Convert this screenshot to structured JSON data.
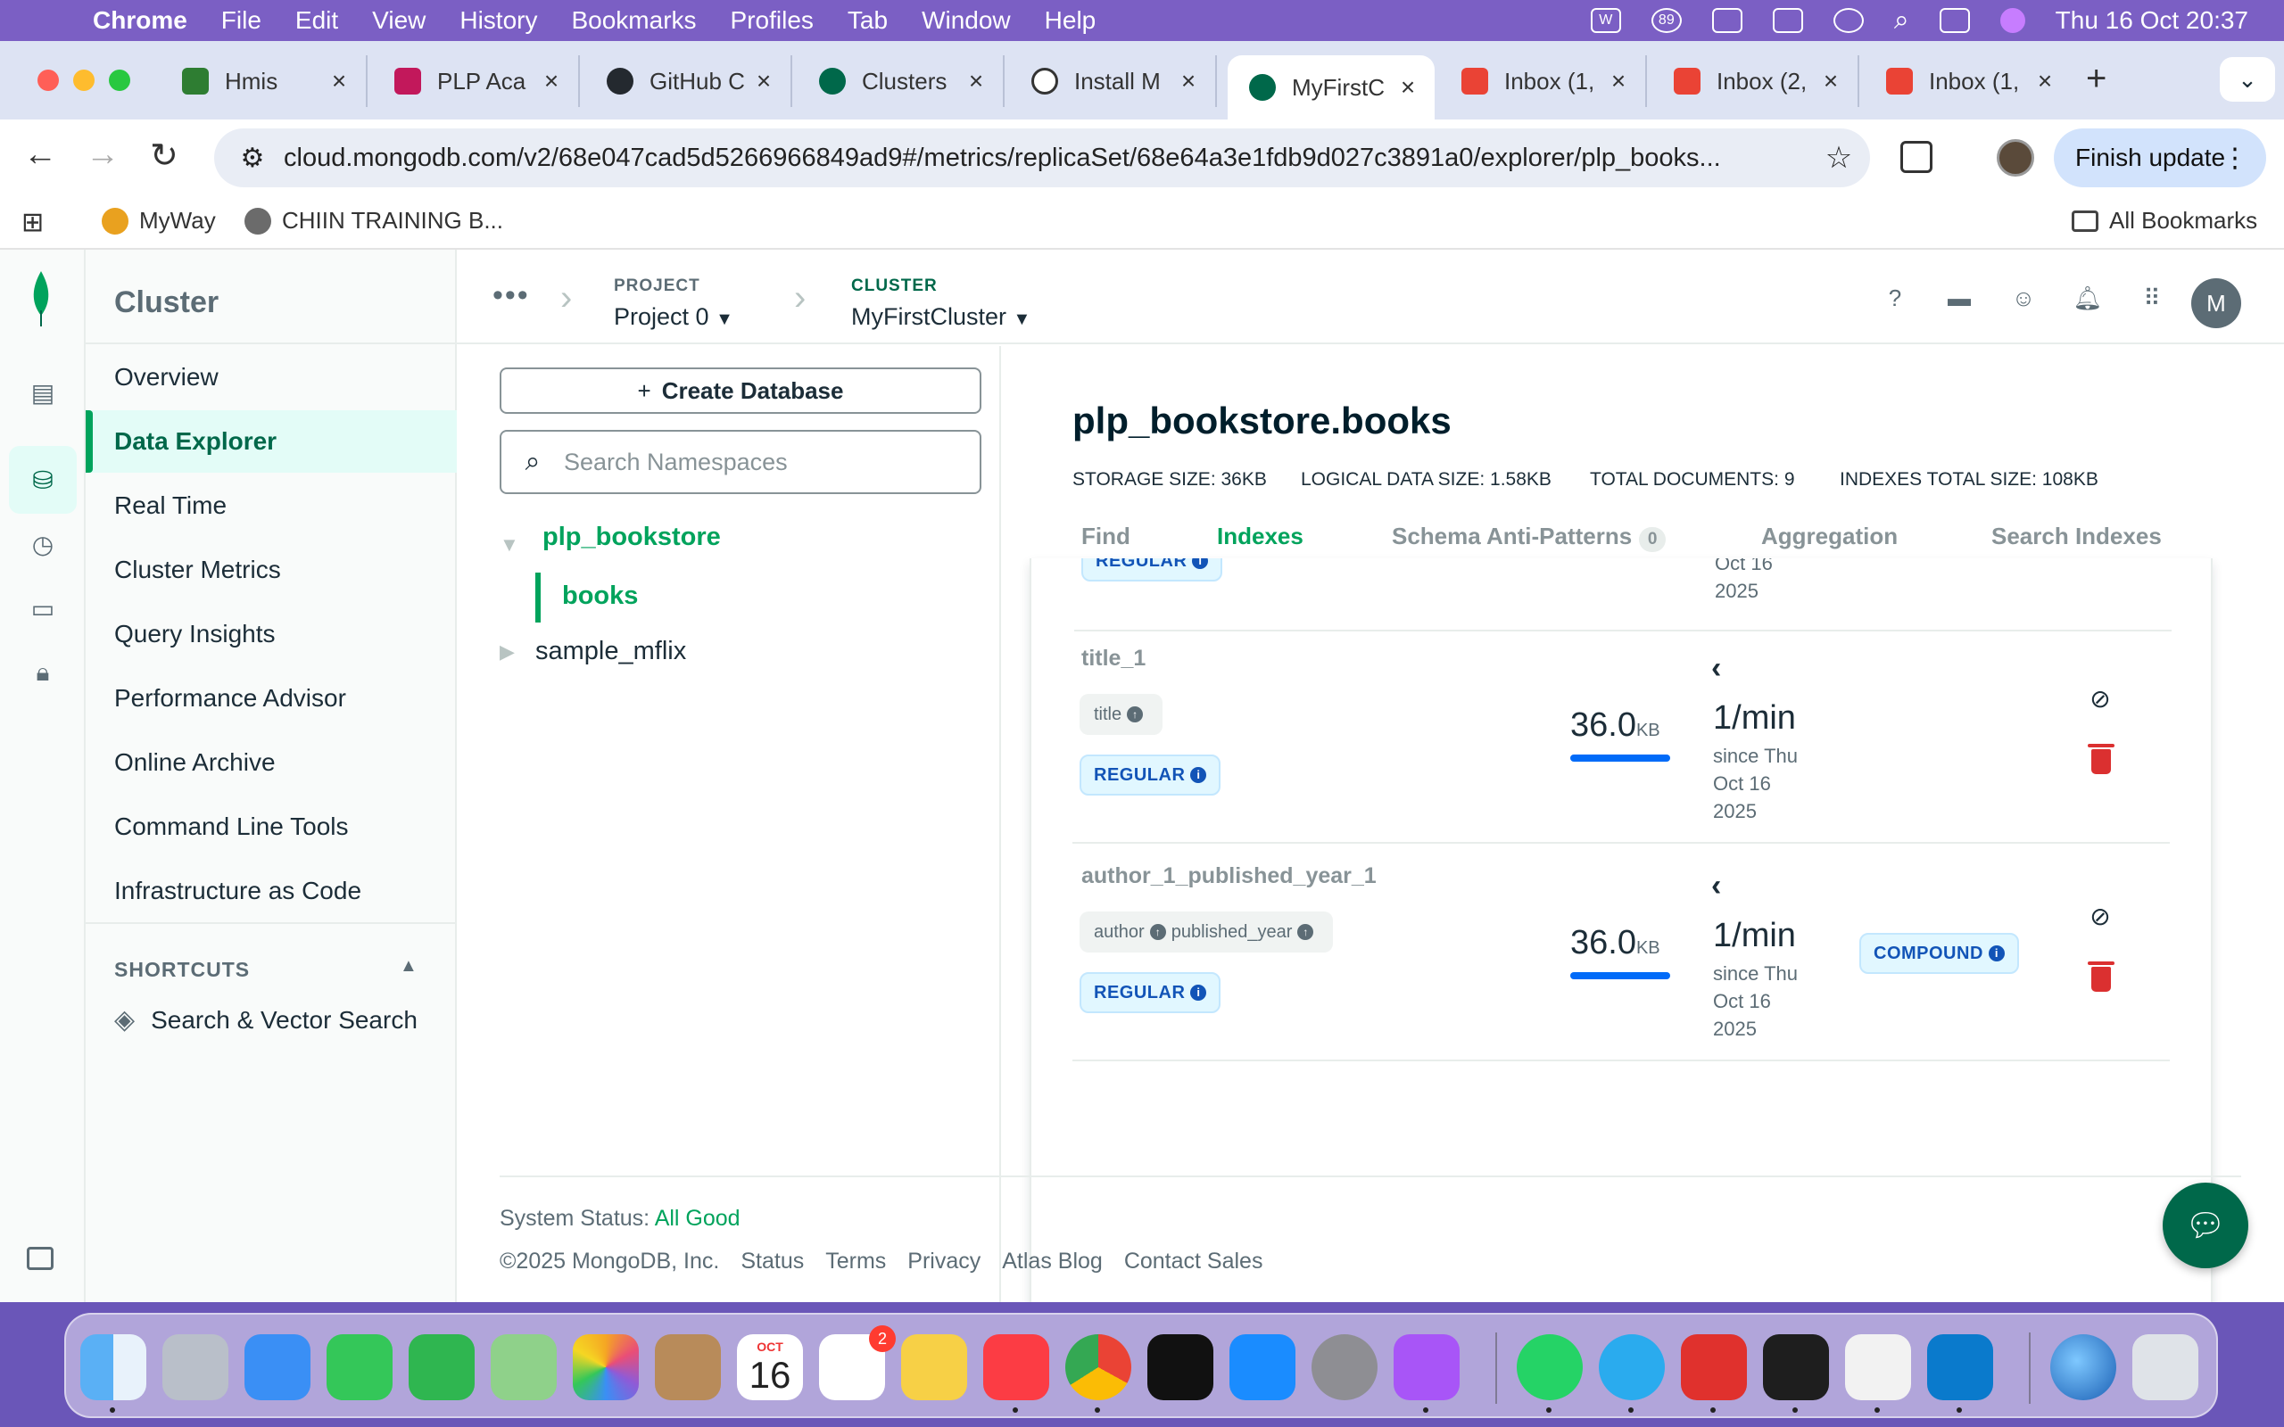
{
  "menubar": {
    "app_name": "Chrome",
    "items": [
      "File",
      "Edit",
      "View",
      "History",
      "Bookmarks",
      "Profiles",
      "Tab",
      "Window",
      "Help"
    ],
    "clock": "Thu 16 Oct  20:37",
    "status_badge": "89"
  },
  "tabs": [
    {
      "title": "Hmis",
      "color": "#2e7d32"
    },
    {
      "title": "PLP Aca",
      "color": "#c2185b"
    },
    {
      "title": "GitHub C",
      "color": "#24292f"
    },
    {
      "title": "Clusters",
      "color": "#00684a"
    },
    {
      "title": "Install M",
      "color": "#333333"
    },
    {
      "title": "MyFirstC",
      "color": "#00684a",
      "active": true
    },
    {
      "title": "Inbox (1,",
      "color": "#ea4335"
    },
    {
      "title": "Inbox (2,",
      "color": "#ea4335"
    },
    {
      "title": "Inbox (1,",
      "color": "#ea4335"
    }
  ],
  "toolbar": {
    "url": "cloud.mongodb.com/v2/68e047cad5d5266966849ad9#/metrics/replicaSet/68e64a3e1fdb9d027c3891a0/explorer/plp_books...",
    "finish_update": "Finish update"
  },
  "bookmarks": {
    "items": [
      "MyWay",
      "CHIIN TRAINING B..."
    ],
    "all_bookmarks": "All Bookmarks"
  },
  "sidenav": {
    "heading": "Cluster",
    "items": [
      "Overview",
      "Data Explorer",
      "Real Time",
      "Cluster Metrics",
      "Query Insights",
      "Performance Advisor",
      "Online Archive",
      "Command Line Tools",
      "Infrastructure as Code"
    ],
    "active_index": 1,
    "shortcuts_heading": "SHORTCUTS",
    "shortcut_item": "Search & Vector Search"
  },
  "header": {
    "project_label": "PROJECT",
    "project_value": "Project 0",
    "cluster_label": "CLUSTER",
    "cluster_value": "MyFirstCluster",
    "avatar_initial": "M"
  },
  "namespaces": {
    "create_button": "Create Database",
    "search_placeholder": "Search Namespaces",
    "database": "plp_bookstore",
    "collection": "books",
    "other_database": "sample_mflix"
  },
  "collection": {
    "title": "plp_bookstore.books",
    "stats": {
      "storage_size_label": "STORAGE SIZE:",
      "storage_size": "36KB",
      "logical_size_label": "LOGICAL DATA SIZE:",
      "logical_size": "1.58KB",
      "total_docs_label": "TOTAL DOCUMENTS:",
      "total_docs": "9",
      "indexes_size_label": "INDEXES TOTAL SIZE:",
      "indexes_size": "108KB"
    },
    "tabs": [
      "Find",
      "Indexes",
      "Schema Anti-Patterns",
      "Aggregation",
      "Search Indexes"
    ],
    "active_tab": "Indexes",
    "anti_patterns_count": "0"
  },
  "indexes": {
    "partial_top": {
      "badge": "REGULAR",
      "since_lines": [
        "Oct 16",
        "2025"
      ]
    },
    "rows": [
      {
        "name": "title_1",
        "keys": [
          "title"
        ],
        "type_badge": "REGULAR",
        "size_value": "36.0",
        "size_unit": "KB",
        "size_fraction": 1.0,
        "usage_rate": "1/min",
        "since_lines": [
          "since Thu",
          "Oct 16",
          "2025"
        ],
        "properties": ""
      },
      {
        "name": "author_1_published_year_1",
        "keys": [
          "author",
          "published_year"
        ],
        "type_badge": "REGULAR",
        "size_value": "36.0",
        "size_unit": "KB",
        "size_fraction": 1.0,
        "usage_rate": "1/min",
        "since_lines": [
          "since Thu",
          "Oct 16",
          "2025"
        ],
        "properties": "COMPOUND"
      }
    ]
  },
  "footer": {
    "status_label": "System Status:",
    "status_value": "All Good",
    "copyright": "©2025 MongoDB, Inc.",
    "links": [
      "Status",
      "Terms",
      "Privacy",
      "Atlas Blog",
      "Contact Sales"
    ]
  },
  "dock": {
    "calendar_month": "OCT",
    "calendar_day": "16",
    "reminders_badge": "2"
  }
}
